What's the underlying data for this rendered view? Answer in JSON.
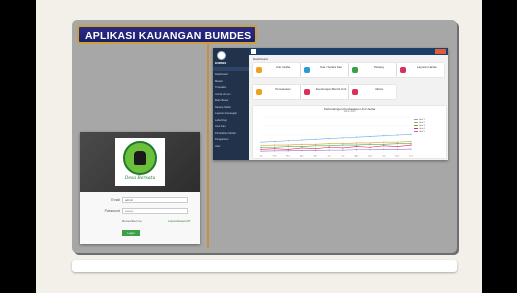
{
  "slide": {
    "title": "APLIKASI KAUANGAN BUMDES"
  },
  "login": {
    "logo_text": "Desa Bersatu",
    "username_label": "Email",
    "username_value": "admin",
    "password_label": "Password",
    "password_value": "••••••••",
    "remember_label": "Remember me",
    "forgot_label": "Lupa Password?",
    "login_button": "Login"
  },
  "dashboard": {
    "heading": "Dashboard",
    "sidebar": {
      "brand": "BUMDES",
      "items": [
        "Dashboard",
        "Master",
        "Transaksi",
        "Jurnal Umum",
        "Buku Besar",
        "Neraca Saldo",
        "Laporan Keuangan",
        "Laba Rugi",
        "Arus Kas",
        "Perubahan Modal",
        "Pengaturan",
        "User"
      ]
    },
    "cards": [
      {
        "label": "Unit Usaha",
        "color": "#f0a020"
      },
      {
        "label": "Kas / Setara Kas",
        "color": "#2a9ad6"
      },
      {
        "label": "Piutang",
        "color": "#3aa04a"
      },
      {
        "label": "Laporan Harian",
        "color": "#d8315b"
      },
      {
        "label": "Pemasukan",
        "color": "#f0a020"
      },
      {
        "label": "Keuntungan Bersih Unit",
        "color": "#d8315b"
      },
      {
        "label": "Aktiva",
        "color": "#d8315b"
      }
    ],
    "chart_title": "Perbandingan Pendapatan Unit Usaha",
    "chart_sub": "Tahun 2023"
  },
  "chart_data": {
    "type": "line",
    "title": "Perbandingan Pendapatan Unit Usaha",
    "categories": [
      "Jan",
      "Feb",
      "Mar",
      "Apr",
      "Mei",
      "Jun",
      "Jul",
      "Agu",
      "Sep",
      "Okt",
      "Nov",
      "Des"
    ],
    "ylim": [
      0,
      100
    ],
    "series": [
      {
        "name": "Unit 1",
        "color": "#6fb0e0",
        "values": [
          30,
          32,
          34,
          36,
          38,
          40,
          42,
          44,
          46,
          48,
          50,
          52
        ]
      },
      {
        "name": "Unit 2",
        "color": "#e0a030",
        "values": [
          20,
          22,
          22,
          24,
          24,
          26,
          26,
          28,
          28,
          30,
          30,
          32
        ]
      },
      {
        "name": "Unit 3",
        "color": "#4caf50",
        "values": [
          15,
          16,
          18,
          18,
          20,
          20,
          22,
          22,
          24,
          24,
          26,
          26
        ]
      },
      {
        "name": "Unit 4",
        "color": "#d8315b",
        "values": [
          10,
          12,
          10,
          14,
          12,
          16,
          14,
          18,
          16,
          20,
          18,
          22
        ]
      },
      {
        "name": "Unit 5",
        "color": "#9b6fd0",
        "values": [
          5,
          6,
          6,
          7,
          7,
          8,
          8,
          9,
          9,
          10,
          10,
          11
        ]
      }
    ]
  }
}
